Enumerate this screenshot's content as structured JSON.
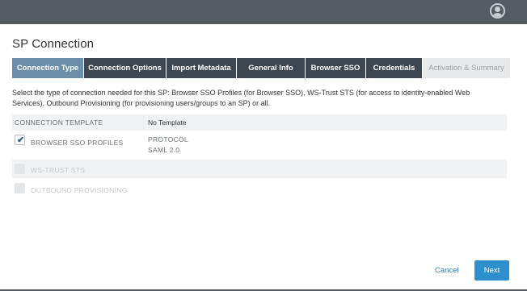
{
  "header": {
    "avatar_icon": "user-avatar-icon"
  },
  "page": {
    "title": "SP Connection"
  },
  "tabs": [
    {
      "label": "Connection Type",
      "state": "active"
    },
    {
      "label": "Connection Options",
      "state": "normal"
    },
    {
      "label": "Import Metadata",
      "state": "normal"
    },
    {
      "label": "General Info",
      "state": "normal"
    },
    {
      "label": "Browser SSO",
      "state": "normal"
    },
    {
      "label": "Credentials",
      "state": "normal"
    },
    {
      "label": "Activation & Summary",
      "state": "disabled"
    }
  ],
  "description": "Select the type of connection needed for this SP: Browser SSO Profiles (for Browser SSO), WS-Trust STS (for access to identity-enabled Web Services), Outbound Provisioning (for provisioning users/groups to an SP) or all.",
  "table": {
    "header_label": "CONNECTION TEMPLATE",
    "template_value": "No Template",
    "rows": [
      {
        "label": "BROWSER SSO PROFILES",
        "checked": true,
        "enabled": true,
        "protocol_label": "PROTOCOL",
        "protocol_value": "SAML 2.0"
      },
      {
        "label": "WS-TRUST STS",
        "checked": false,
        "enabled": false
      },
      {
        "label": "OUTBOUND PROVISIONING",
        "checked": false,
        "enabled": false
      }
    ]
  },
  "footer": {
    "cancel_label": "Cancel",
    "next_label": "Next"
  },
  "colors": {
    "topbar": "#565b62",
    "tab_dark": "#3d4752",
    "tab_active": "#6d8ea8",
    "primary": "#2e8fcf"
  }
}
